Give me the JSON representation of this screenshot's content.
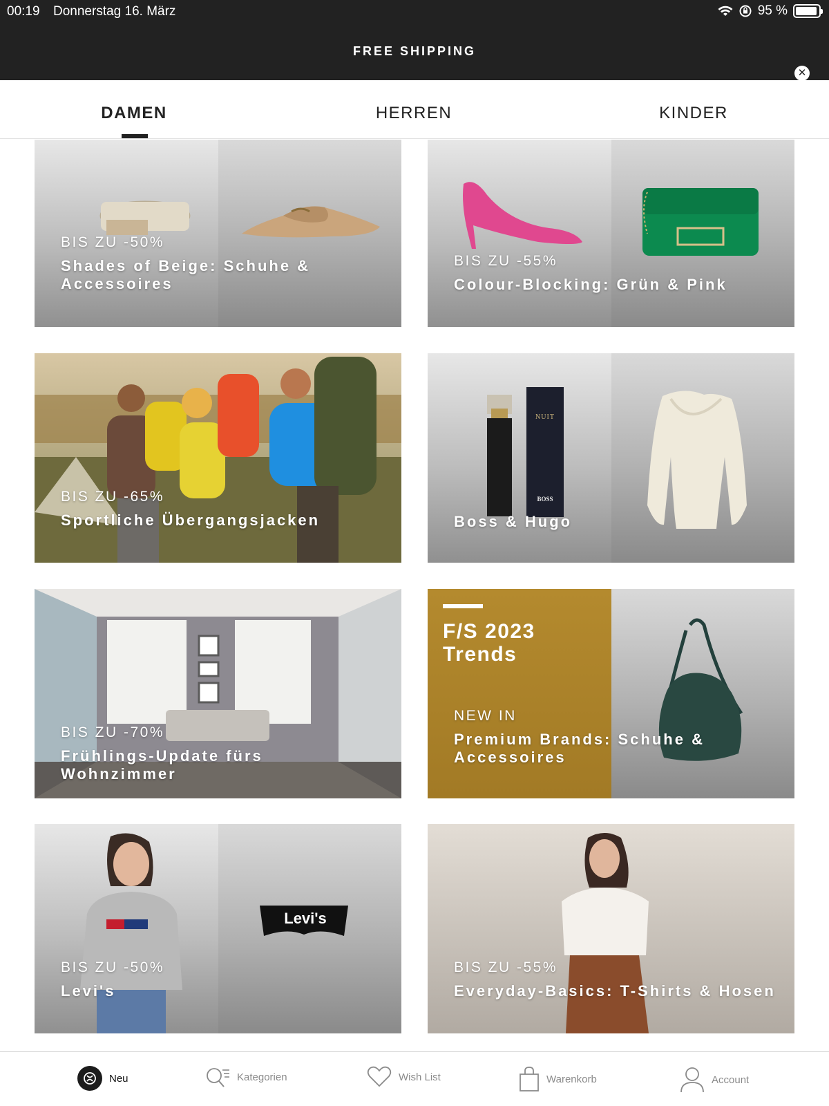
{
  "status_bar": {
    "time": "00:19",
    "date": "Donnerstag 16. März",
    "battery_text": "95 %",
    "battery_level": 0.95
  },
  "promo": {
    "text": "FREE SHIPPING"
  },
  "tabs": [
    {
      "label": "DAMEN",
      "active": true
    },
    {
      "label": "HERREN",
      "active": false
    },
    {
      "label": "KINDER",
      "active": false
    }
  ],
  "tiles": [
    {
      "discount": "BIS ZU -50%",
      "title": "Shades of Beige: Schuhe & Accessoires"
    },
    {
      "discount": "BIS ZU -55%",
      "title": "Colour-Blocking: Grün & Pink"
    },
    {
      "discount": "BIS ZU -65%",
      "title": "Sportliche Übergangsjacken"
    },
    {
      "discount": "",
      "title": "Boss & Hugo"
    },
    {
      "discount": "BIS ZU -70%",
      "title": "Frühlings-Update fürs Wohnzimmer"
    },
    {
      "discount": "NEW IN",
      "title": "Premium Brands: Schuhe & Accessoires",
      "overlay": "F/S 2023\nTrends"
    },
    {
      "discount": "BIS ZU -50%",
      "title": "Levi's"
    },
    {
      "discount": "BIS ZU -55%",
      "title": "Everyday-Basics: T-Shirts & Hosen"
    }
  ],
  "product_text": {
    "perfume_box": "NUIT",
    "perfume_brand": "BOSS",
    "levis_logo": "Levi's"
  },
  "bottom_nav": [
    {
      "label": "Neu",
      "icon": "neu-icon",
      "active": true
    },
    {
      "label": "Kategorien",
      "icon": "search-categories-icon",
      "active": false
    },
    {
      "label": "Wish List",
      "icon": "heart-icon",
      "active": false
    },
    {
      "label": "Warenkorb",
      "icon": "shopping-bag-icon",
      "active": false
    },
    {
      "label": "Account",
      "icon": "user-icon",
      "active": false
    }
  ],
  "colors": {
    "dark_bar": "#222222",
    "gold_panel": "#a9802a",
    "tab_indicator": "#222222",
    "inactive_nav": "#8a8a8a"
  }
}
